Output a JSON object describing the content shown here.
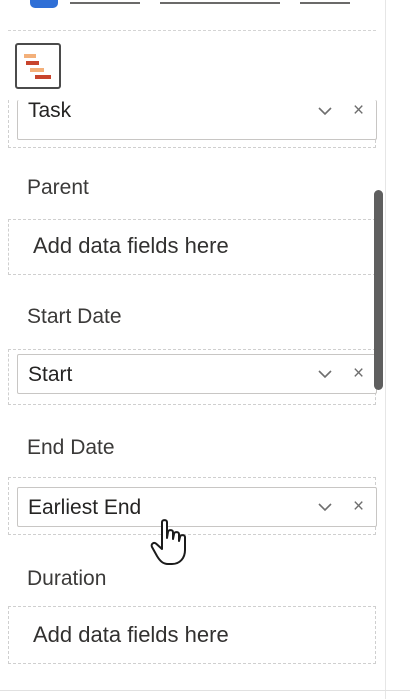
{
  "icons": {
    "gantt_visual": "gantt-chart-icon",
    "chevron": "chevron-down-icon",
    "remove": "close-icon",
    "cursor": "hand-pointer-cursor-icon"
  },
  "colors": {
    "gantt_bar_light": "#f3b07a",
    "gantt_bar_dark": "#c8442c",
    "scrollbar": "#5f5f5f",
    "accent_chip": "#2f6fd6"
  },
  "glyphs": {
    "remove": "×"
  },
  "fields": {
    "task": {
      "value": "Task"
    },
    "parent": {
      "label": "Parent",
      "placeholder": "Add data fields here"
    },
    "start_date": {
      "label": "Start Date",
      "value": "Start"
    },
    "end_date": {
      "label": "End Date",
      "value": "Earliest End"
    },
    "duration": {
      "label": "Duration",
      "placeholder": "Add data fields here"
    }
  }
}
